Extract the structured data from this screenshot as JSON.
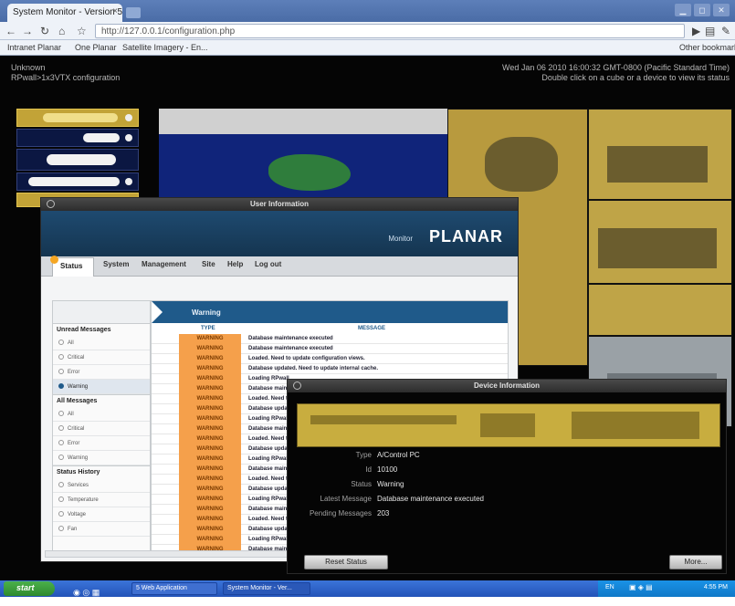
{
  "browser": {
    "tab_title": "System Monitor - Version 5...",
    "tab_close": "×",
    "url": "http://127.0.0.1/configuration.php",
    "bookmarks": [
      "Intranet Planar",
      "One Planar",
      "Satellite Imagery - En...",
      "Other bookmarks"
    ]
  },
  "app": {
    "location_line1": "Unknown",
    "location_line2": "RPwall>1x3VTX configuration",
    "datetime": "Wed Jan 06 2010 16:00:32 GMT-0800 (Pacific Standard Time)",
    "hint": "Double click on a cube or a device to view its status"
  },
  "user_window": {
    "title": "User Information",
    "brand_monitor": "Monitor",
    "brand_logo": "PLANAR",
    "nav_tabs": [
      "Status",
      "System",
      "Management",
      "Site",
      "Help",
      "Log out"
    ],
    "banner_label": "Warning",
    "col_type": "TYPE",
    "col_message": "MESSAGE",
    "sidebar": {
      "unread_header": "Unread Messages",
      "unread_items": [
        "All",
        "Critical",
        "Error",
        "Warning"
      ],
      "all_header": "All Messages",
      "all_items": [
        "All",
        "Critical",
        "Error",
        "Warning"
      ],
      "status_header": "Status History",
      "status_items": [
        "Services",
        "Temperature",
        "Voltage",
        "Fan"
      ]
    },
    "messages": [
      {
        "type": "WARNING",
        "message": "Database maintenance executed"
      },
      {
        "type": "WARNING",
        "message": "Database maintenance executed"
      },
      {
        "type": "WARNING",
        "message": "Loaded. Need to update configuration views."
      },
      {
        "type": "WARNING",
        "message": "Database updated. Need to update internal cache."
      },
      {
        "type": "WARNING",
        "message": "Loading RPwall"
      },
      {
        "type": "WARNING",
        "message": "Database maintenance"
      },
      {
        "type": "WARNING",
        "message": "Loaded. Need to update"
      },
      {
        "type": "WARNING",
        "message": "Database updated"
      },
      {
        "type": "WARNING",
        "message": "Loading RPwall"
      },
      {
        "type": "WARNING",
        "message": "Database maintenance"
      },
      {
        "type": "WARNING",
        "message": "Loaded. Need to update"
      },
      {
        "type": "WARNING",
        "message": "Database updated"
      },
      {
        "type": "WARNING",
        "message": "Loading RPwall"
      },
      {
        "type": "WARNING",
        "message": "Database maintenance"
      },
      {
        "type": "WARNING",
        "message": "Loaded. Need to update"
      },
      {
        "type": "WARNING",
        "message": "Database updated"
      },
      {
        "type": "WARNING",
        "message": "Loading RPwall"
      },
      {
        "type": "WARNING",
        "message": "Database maintenance"
      },
      {
        "type": "WARNING",
        "message": "Loaded. Need to update"
      },
      {
        "type": "WARNING",
        "message": "Database updated"
      },
      {
        "type": "WARNING",
        "message": "Loading RPwall"
      },
      {
        "type": "WARNING",
        "message": "Database maintenance"
      }
    ]
  },
  "device_window": {
    "title": "Device Information",
    "fields": [
      {
        "label": "Type",
        "value": "A/Control PC"
      },
      {
        "label": "Id",
        "value": "10100"
      },
      {
        "label": "Status",
        "value": "Warning"
      },
      {
        "label": "Latest Message",
        "value": "Database maintenance executed"
      },
      {
        "label": "Pending Messages",
        "value": "203"
      }
    ],
    "reset_button": "Reset Status",
    "more_button": "More..."
  },
  "taskbar": {
    "start": "start",
    "tasks": [
      "5 Web Application",
      "System Monitor - Ver..."
    ],
    "clock": "4:55 PM",
    "lang": "EN"
  },
  "colors": {
    "accent_blue": "#1f5a8a",
    "warning_orange": "#f5a04b",
    "tile_gold": "#bfa447"
  }
}
